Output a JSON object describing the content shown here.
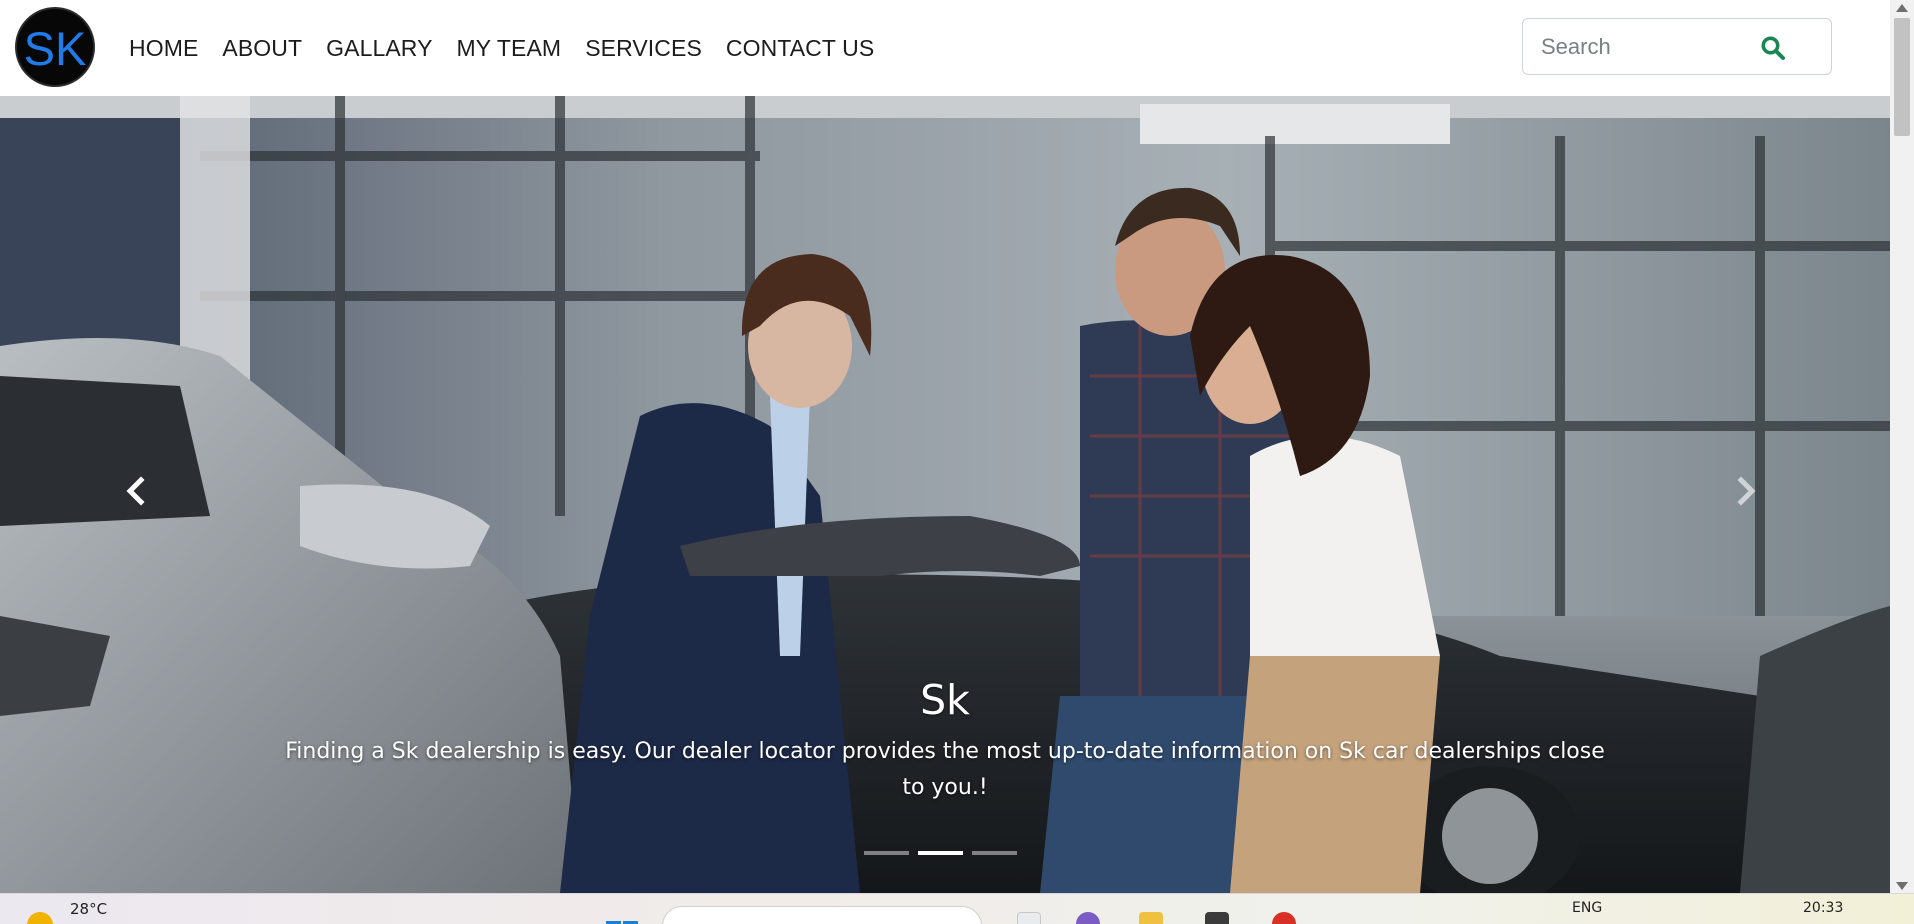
{
  "logo": {
    "text": "SK"
  },
  "nav": {
    "items": [
      {
        "label": "HOME"
      },
      {
        "label": "ABOUT"
      },
      {
        "label": "GALLARY"
      },
      {
        "label": "MY TEAM"
      },
      {
        "label": "SERVICES"
      },
      {
        "label": "CONTACT US"
      }
    ]
  },
  "search": {
    "placeholder": "Search",
    "icon": "search-icon",
    "icon_color": "#198754"
  },
  "carousel": {
    "title": "Sk",
    "text": "Finding a Sk dealership is easy. Our dealer locator provides the most up-to-date information on Sk car dealerships close to you.!",
    "slide_count": 3,
    "active_slide": 2,
    "prev_icon": "chevron-left-icon",
    "next_icon": "chevron-right-icon"
  },
  "taskbar": {
    "temperature": "28°C",
    "language": "ENG",
    "time": "20:33"
  },
  "colors": {
    "logo_bg": "#070707",
    "logo_text": "#1f7be8",
    "nav_text": "#1c1c1c",
    "search_icon": "#198754"
  }
}
